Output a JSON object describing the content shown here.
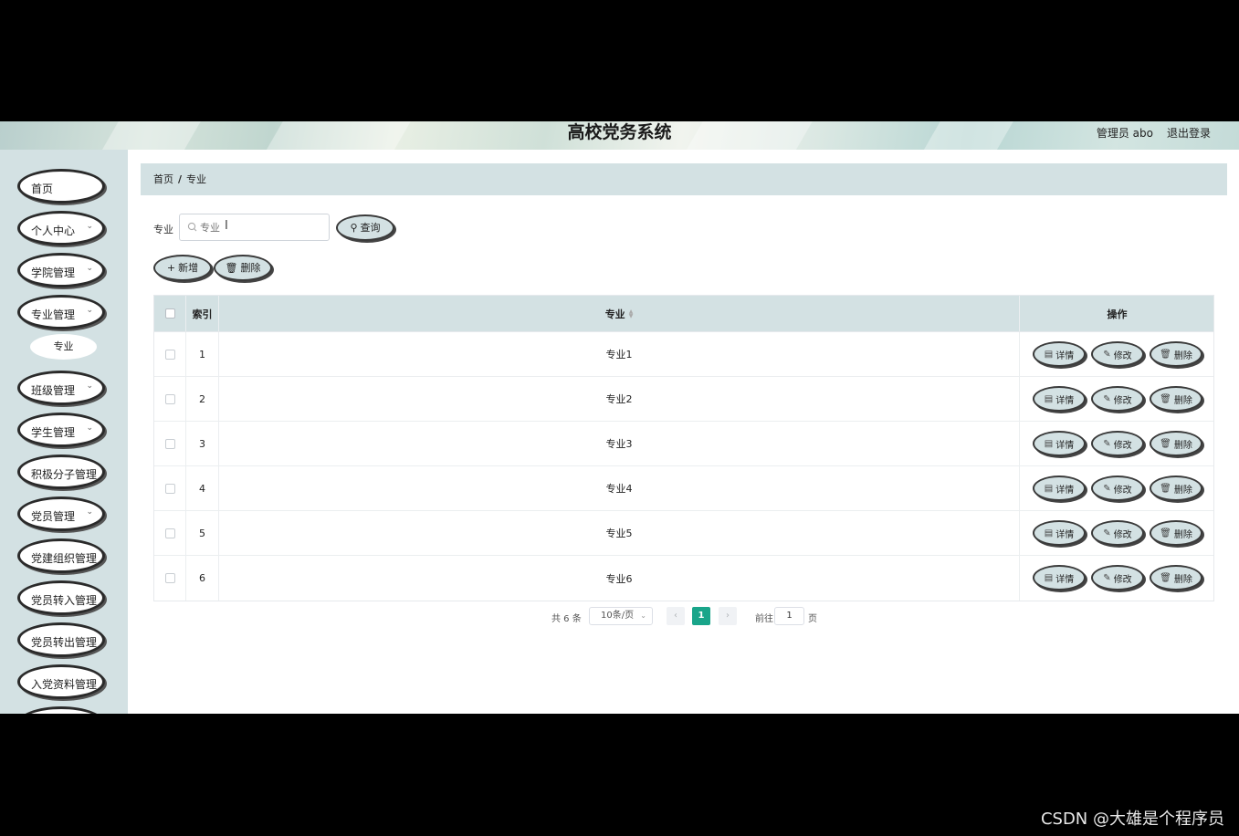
{
  "header": {
    "title": "高校党务系统",
    "user_label": "管理员 abo",
    "logout_label": "退出登录"
  },
  "sidebar": {
    "items": [
      {
        "label": "首页",
        "has_children": false
      },
      {
        "label": "个人中心",
        "has_children": true
      },
      {
        "label": "学院管理",
        "has_children": true
      },
      {
        "label": "专业管理",
        "has_children": true
      },
      {
        "label": "班级管理",
        "has_children": true
      },
      {
        "label": "学生管理",
        "has_children": true
      },
      {
        "label": "积极分子管理",
        "has_children": false
      },
      {
        "label": "党员管理",
        "has_children": true
      },
      {
        "label": "党建组织管理",
        "has_children": false
      },
      {
        "label": "党员转入管理",
        "has_children": false
      },
      {
        "label": "党员转出管理",
        "has_children": false
      },
      {
        "label": "入党资料管理",
        "has_children": false
      }
    ],
    "sub_item": "专业"
  },
  "breadcrumb": {
    "home": "首页",
    "separator": "/",
    "current": "专业"
  },
  "search": {
    "label": "专业",
    "placeholder": "专业",
    "query_button": "查询"
  },
  "toolbar": {
    "add_label": "新增",
    "delete_label": "删除"
  },
  "table": {
    "headers": {
      "index": "索引",
      "name": "专业",
      "ops": "操作"
    },
    "rows": [
      {
        "index": "1",
        "name": "专业1"
      },
      {
        "index": "2",
        "name": "专业2"
      },
      {
        "index": "3",
        "name": "专业3"
      },
      {
        "index": "4",
        "name": "专业4"
      },
      {
        "index": "5",
        "name": "专业5"
      },
      {
        "index": "6",
        "name": "专业6"
      }
    ],
    "row_actions": {
      "detail": "详情",
      "edit": "修改",
      "delete": "删除"
    }
  },
  "pagination": {
    "total_text": "共 6 条",
    "page_size": "10条/页",
    "current_page": "1",
    "goto_label": "前往",
    "goto_value": "1",
    "page_unit": "页"
  },
  "watermark": "CSDN @大雄是个程序员",
  "colors": {
    "accent": "#d3e1e3",
    "page_active": "#19a58a"
  }
}
